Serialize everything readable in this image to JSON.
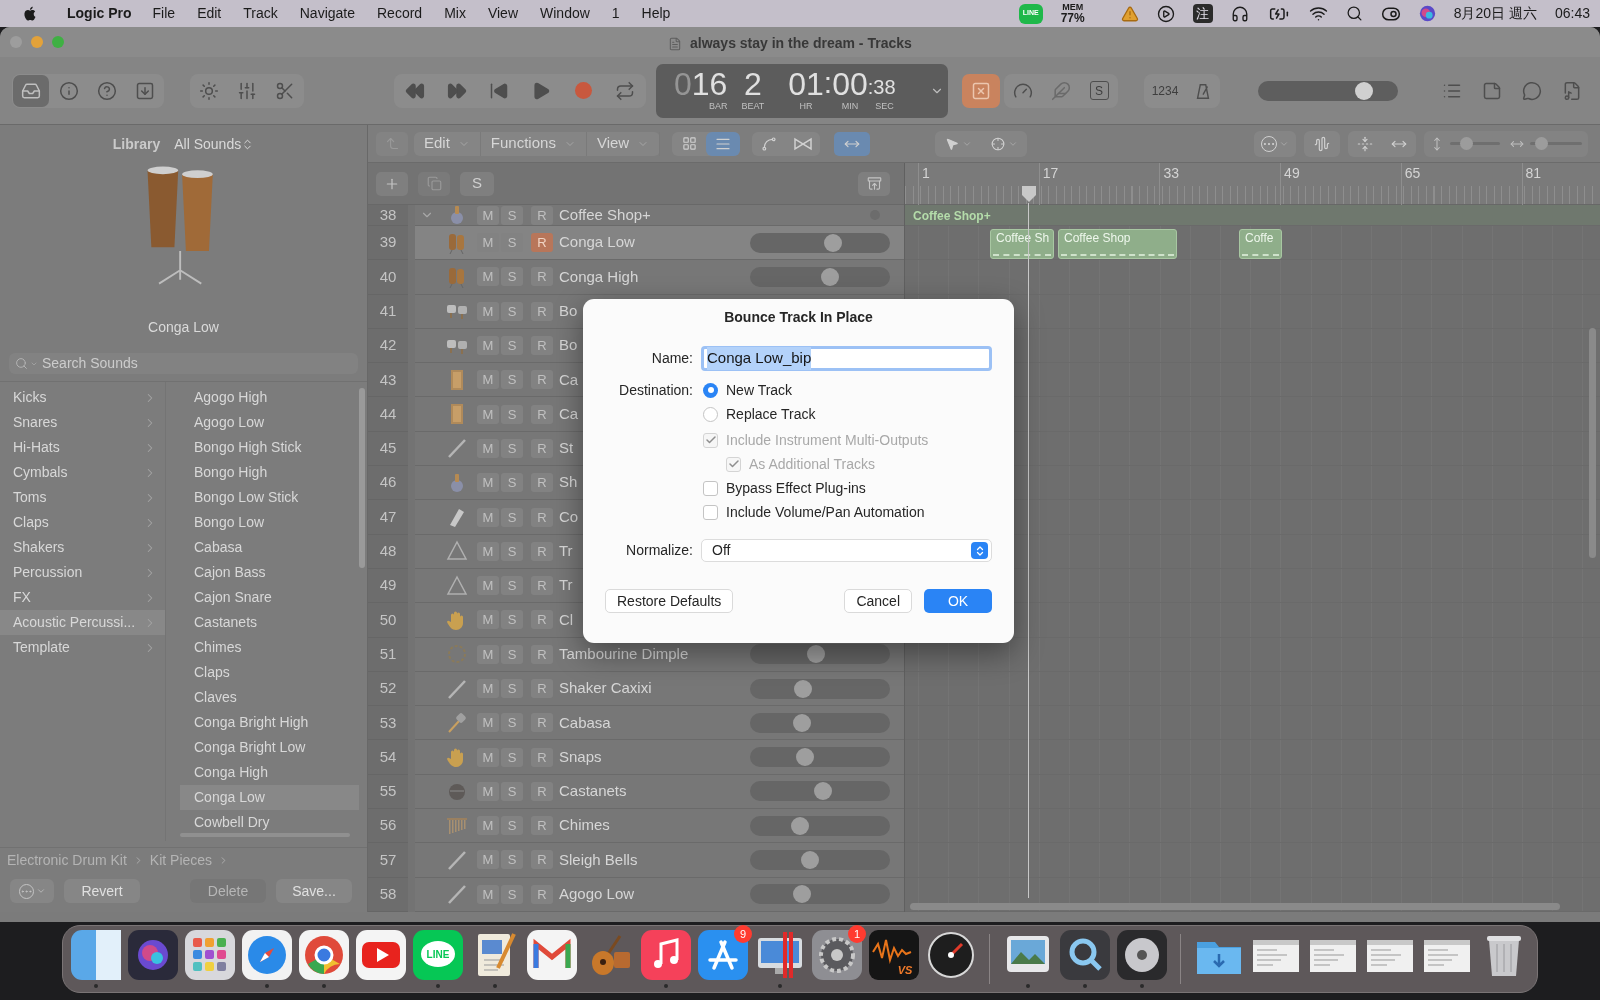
{
  "menu_bar": {
    "app": "Logic Pro",
    "menus": [
      "File",
      "Edit",
      "Track",
      "Navigate",
      "Record",
      "Mix",
      "View",
      "Window",
      "1",
      "Help"
    ],
    "line_icon": "LINE",
    "mem_label": "MEM",
    "mem_value": "77%",
    "input_method": "注",
    "date": "8月20日 週六",
    "time": "06:43"
  },
  "window": {
    "title": "always stay in the dream - Tracks"
  },
  "control_bar": {
    "library_open": true,
    "replace_on": true,
    "solo_label": "S",
    "count_in": "1234",
    "master_volume": {
      "level": 0.76
    }
  },
  "lcd": {
    "bar_lead": "0",
    "bar": "16",
    "beat": "2",
    "hr": "01",
    "sep1": ":",
    "min": "00",
    "sep2": ":",
    "sec": "38",
    "labels": [
      "BAR",
      "BEAT",
      "HR",
      "MIN",
      "SEC"
    ]
  },
  "library": {
    "title": "Library",
    "selector": "All Sounds",
    "patch_name": "Conga Low",
    "search": {
      "placeholder": "Search Sounds"
    },
    "categories": [
      {
        "label": "Kicks",
        "selected": false
      },
      {
        "label": "Snares",
        "selected": false
      },
      {
        "label": "Hi-Hats",
        "selected": false
      },
      {
        "label": "Cymbals",
        "selected": false
      },
      {
        "label": "Toms",
        "selected": false
      },
      {
        "label": "Claps",
        "selected": false
      },
      {
        "label": "Shakers",
        "selected": false
      },
      {
        "label": "Percussion",
        "selected": false
      },
      {
        "label": "FX",
        "selected": false
      },
      {
        "label": "Acoustic Percussi...",
        "selected": true
      },
      {
        "label": "Template",
        "selected": false
      }
    ],
    "sounds": [
      {
        "label": "Agogo High",
        "selected": false
      },
      {
        "label": "Agogo Low",
        "selected": false
      },
      {
        "label": "Bongo High Stick",
        "selected": false
      },
      {
        "label": "Bongo High",
        "selected": false
      },
      {
        "label": "Bongo Low Stick",
        "selected": false
      },
      {
        "label": "Bongo Low",
        "selected": false
      },
      {
        "label": "Cabasa",
        "selected": false
      },
      {
        "label": "Cajon Bass",
        "selected": false
      },
      {
        "label": "Cajon Snare",
        "selected": false
      },
      {
        "label": "Castanets",
        "selected": false
      },
      {
        "label": "Chimes",
        "selected": false
      },
      {
        "label": "Claps",
        "selected": false
      },
      {
        "label": "Claves",
        "selected": false
      },
      {
        "label": "Conga Bright High",
        "selected": false
      },
      {
        "label": "Conga Bright Low",
        "selected": false
      },
      {
        "label": "Conga High",
        "selected": false
      },
      {
        "label": "Conga Low",
        "selected": true
      },
      {
        "label": "Cowbell Dry",
        "selected": false
      }
    ],
    "path": [
      "Electronic Drum Kit",
      "Kit Pieces"
    ],
    "buttons": [
      {
        "label": "Revert",
        "disabled": false
      },
      {
        "label": "Delete",
        "disabled": true
      },
      {
        "label": "Save...",
        "disabled": false
      }
    ]
  },
  "tracks_toolbar": {
    "menus": [
      "Edit",
      "Functions",
      "View"
    ],
    "view_buttons": [
      {
        "selected": false
      },
      {
        "selected": true
      }
    ],
    "catch_on": true
  },
  "track_header": {
    "solo_label": "S"
  },
  "tracks": [
    {
      "kind": "folder",
      "number": "38",
      "name": "Coffee Shop+",
      "expanded": true,
      "selected": false,
      "record": false,
      "buttons": [
        "M",
        "S",
        "R"
      ]
    },
    {
      "kind": "track",
      "number": "39",
      "name": "Conga Low",
      "selected": true,
      "record": true,
      "level": 0.59,
      "buttons": [
        "M",
        "S",
        "R"
      ]
    },
    {
      "kind": "track",
      "number": "40",
      "name": "Conga High",
      "selected": false,
      "record": false,
      "level": 0.57,
      "buttons": [
        "M",
        "S",
        "R"
      ]
    },
    {
      "kind": "track",
      "number": "41",
      "name": "Bo",
      "selected": false,
      "record": false,
      "buttons": [
        "M",
        "S",
        "R"
      ]
    },
    {
      "kind": "track",
      "number": "42",
      "name": "Bo",
      "selected": false,
      "record": false,
      "buttons": [
        "M",
        "S",
        "R"
      ]
    },
    {
      "kind": "track",
      "number": "43",
      "name": "Ca",
      "selected": false,
      "record": false,
      "buttons": [
        "M",
        "S",
        "R"
      ]
    },
    {
      "kind": "track",
      "number": "44",
      "name": "Ca",
      "selected": false,
      "record": false,
      "buttons": [
        "M",
        "S",
        "R"
      ]
    },
    {
      "kind": "track",
      "number": "45",
      "name": "St",
      "selected": false,
      "record": false,
      "buttons": [
        "M",
        "S",
        "R"
      ]
    },
    {
      "kind": "track",
      "number": "46",
      "name": "Sh",
      "selected": false,
      "record": false,
      "buttons": [
        "M",
        "S",
        "R"
      ]
    },
    {
      "kind": "track",
      "number": "47",
      "name": "Co",
      "selected": false,
      "record": false,
      "buttons": [
        "M",
        "S",
        "R"
      ]
    },
    {
      "kind": "track",
      "number": "48",
      "name": "Tr",
      "selected": false,
      "record": false,
      "buttons": [
        "M",
        "S",
        "R"
      ]
    },
    {
      "kind": "track",
      "number": "49",
      "name": "Tr",
      "selected": false,
      "record": false,
      "buttons": [
        "M",
        "S",
        "R"
      ]
    },
    {
      "kind": "track",
      "number": "50",
      "name": "Cl",
      "selected": false,
      "record": false,
      "buttons": [
        "M",
        "S",
        "R"
      ]
    },
    {
      "kind": "track",
      "number": "51",
      "name": "Tambourine Dimple",
      "selected": false,
      "record": false,
      "level": 0.47,
      "buttons": [
        "M",
        "S",
        "R"
      ]
    },
    {
      "kind": "track",
      "number": "52",
      "name": "Shaker Caxixi",
      "selected": false,
      "record": false,
      "level": 0.38,
      "buttons": [
        "M",
        "S",
        "R"
      ]
    },
    {
      "kind": "track",
      "number": "53",
      "name": "Cabasa",
      "selected": false,
      "record": false,
      "level": 0.37,
      "buttons": [
        "M",
        "S",
        "R"
      ]
    },
    {
      "kind": "track",
      "number": "54",
      "name": "Snaps",
      "selected": false,
      "record": false,
      "level": 0.39,
      "buttons": [
        "M",
        "S",
        "R"
      ]
    },
    {
      "kind": "track",
      "number": "55",
      "name": "Castanets",
      "selected": false,
      "record": false,
      "level": 0.52,
      "buttons": [
        "M",
        "S",
        "R"
      ]
    },
    {
      "kind": "track",
      "number": "56",
      "name": "Chimes",
      "selected": false,
      "record": false,
      "level": 0.36,
      "buttons": [
        "M",
        "S",
        "R"
      ]
    },
    {
      "kind": "track",
      "number": "57",
      "name": "Sleigh Bells",
      "selected": false,
      "record": false,
      "level": 0.43,
      "buttons": [
        "M",
        "S",
        "R"
      ]
    },
    {
      "kind": "track",
      "number": "58",
      "name": "Agogo Low",
      "selected": false,
      "record": false,
      "level": 0.37,
      "buttons": [
        "M",
        "S",
        "R"
      ]
    }
  ],
  "arrange": {
    "zoom": {
      "vertical": {
        "level": 0.26
      },
      "horizontal": {
        "level": 0.13
      }
    },
    "ruler": [
      "1",
      "17",
      "33",
      "49",
      "65",
      "81"
    ],
    "folder_region": "Coffee Shop+",
    "regions": [
      {
        "label": "Coffee Sh"
      },
      {
        "label": "Coffee Shop"
      },
      {
        "label": "Coffe"
      }
    ]
  },
  "dialog": {
    "title": "Bounce Track In Place",
    "name_label": "Name:",
    "name_value": "Conga Low_bip",
    "destination_label": "Destination:",
    "destinations": [
      {
        "label": "New Track",
        "selected": true
      },
      {
        "label": "Replace Track",
        "selected": false
      }
    ],
    "options": [
      {
        "label": "Include Instrument Multi-Outputs",
        "checked": true,
        "disabled": true,
        "children": [
          {
            "label": "As Additional Tracks",
            "checked": true,
            "disabled": true
          }
        ]
      },
      {
        "label": "Bypass Effect Plug-ins",
        "checked": false,
        "disabled": false
      },
      {
        "label": "Include Volume/Pan Automation",
        "checked": false,
        "disabled": false
      }
    ],
    "normalize_label": "Normalize:",
    "normalize_value": "Off",
    "buttons": [
      {
        "label": "Restore Defaults",
        "kind": "secondary"
      },
      {
        "label": "Cancel",
        "kind": "secondary"
      },
      {
        "label": "OK",
        "kind": "default"
      }
    ]
  },
  "dock": [
    {
      "kind": "app",
      "running": true
    },
    {
      "kind": "app",
      "running": false
    },
    {
      "kind": "app",
      "running": false
    },
    {
      "kind": "app",
      "running": true
    },
    {
      "kind": "app",
      "running": true
    },
    {
      "kind": "app",
      "running": false
    },
    {
      "kind": "app",
      "running": true,
      "label": "LINE"
    },
    {
      "kind": "app",
      "running": true
    },
    {
      "kind": "app",
      "running": false
    },
    {
      "kind": "app",
      "running": false
    },
    {
      "kind": "app",
      "running": true
    },
    {
      "kind": "app",
      "running": false,
      "badge": "9"
    },
    {
      "kind": "app",
      "running": true
    },
    {
      "kind": "app",
      "running": false,
      "badge": "1"
    },
    {
      "kind": "app",
      "running": false,
      "label": "VS"
    },
    {
      "kind": "app",
      "running": false
    },
    {
      "kind": "separator"
    },
    {
      "kind": "app",
      "running": true
    },
    {
      "kind": "app",
      "running": true
    },
    {
      "kind": "app",
      "running": true
    },
    {
      "kind": "separator"
    },
    {
      "kind": "folder"
    },
    {
      "kind": "window"
    },
    {
      "kind": "window"
    },
    {
      "kind": "window"
    },
    {
      "kind": "window"
    },
    {
      "kind": "trash"
    }
  ]
}
